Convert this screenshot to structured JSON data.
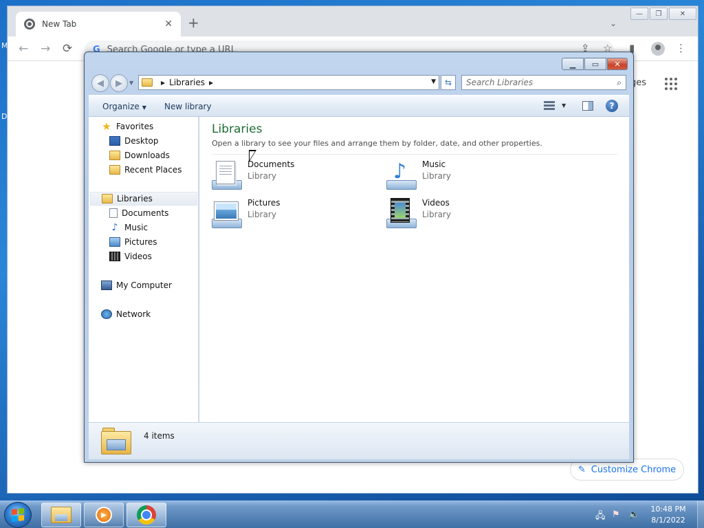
{
  "desktop": {
    "frag1": "M",
    "frag2": "D"
  },
  "chrome": {
    "tab_title": "New Tab",
    "tab_close": "✕",
    "new_tab": "+",
    "tab_menu": "⌄",
    "omnibox_placeholder": "Search Google or type a URL",
    "images_link": "ges",
    "customize_label": "Customize Chrome",
    "back": "←",
    "forward": "→",
    "reload": "⟳"
  },
  "explorer": {
    "breadcrumb": "Libraries",
    "search_placeholder": "Search Libraries",
    "commands": {
      "organize": "Organize",
      "new_library": "New library"
    },
    "nav": {
      "favorites": "Favorites",
      "desktop": "Desktop",
      "downloads": "Downloads",
      "recent_places": "Recent Places",
      "libraries": "Libraries",
      "documents": "Documents",
      "music": "Music",
      "pictures": "Pictures",
      "videos": "Videos",
      "my_computer": "My Computer",
      "network": "Network"
    },
    "content": {
      "title": "Libraries",
      "description": "Open a library to see your files and arrange them by folder, date, and other properties.",
      "items": [
        {
          "name": "Documents",
          "type": "Library"
        },
        {
          "name": "Music",
          "type": "Library"
        },
        {
          "name": "Pictures",
          "type": "Library"
        },
        {
          "name": "Videos",
          "type": "Library"
        }
      ]
    },
    "status": "4 items"
  },
  "taskbar": {
    "time": "10:48 PM",
    "date": "8/1/2022"
  }
}
